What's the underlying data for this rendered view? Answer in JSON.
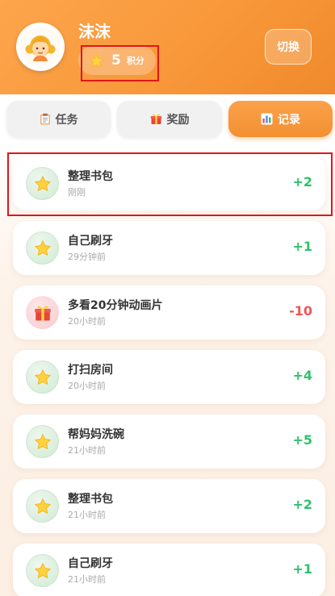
{
  "header": {
    "user_name": "沫沫",
    "points_value": "5",
    "points_unit": "积分",
    "switch_label": "切换"
  },
  "tabs": [
    {
      "label": "任务",
      "icon": "clipboard-icon",
      "active": false
    },
    {
      "label": "奖励",
      "icon": "gift-icon",
      "active": false
    },
    {
      "label": "记录",
      "icon": "bar-chart-icon",
      "active": true
    }
  ],
  "records": [
    {
      "title": "整理书包",
      "time": "刚刚",
      "points": "+2",
      "icon": "star-icon",
      "kind": "plus"
    },
    {
      "title": "自己刷牙",
      "time": "29分钟前",
      "points": "+1",
      "icon": "star-icon",
      "kind": "plus"
    },
    {
      "title": "多看20分钟动画片",
      "time": "20小时前",
      "points": "-10",
      "icon": "gift-icon",
      "kind": "minus"
    },
    {
      "title": "打扫房间",
      "time": "20小时前",
      "points": "+4",
      "icon": "star-icon",
      "kind": "plus"
    },
    {
      "title": "帮妈妈洗碗",
      "time": "21小时前",
      "points": "+5",
      "icon": "star-icon",
      "kind": "plus"
    },
    {
      "title": "整理书包",
      "time": "21小时前",
      "points": "+2",
      "icon": "star-icon",
      "kind": "plus"
    },
    {
      "title": "自己刷牙",
      "time": "21小时前",
      "points": "+1",
      "icon": "star-icon",
      "kind": "plus"
    }
  ],
  "colors": {
    "header_orange": "#f8983a",
    "plus_green": "#2fc26b",
    "minus_red": "#f25454",
    "highlight_red": "#e0161b"
  }
}
